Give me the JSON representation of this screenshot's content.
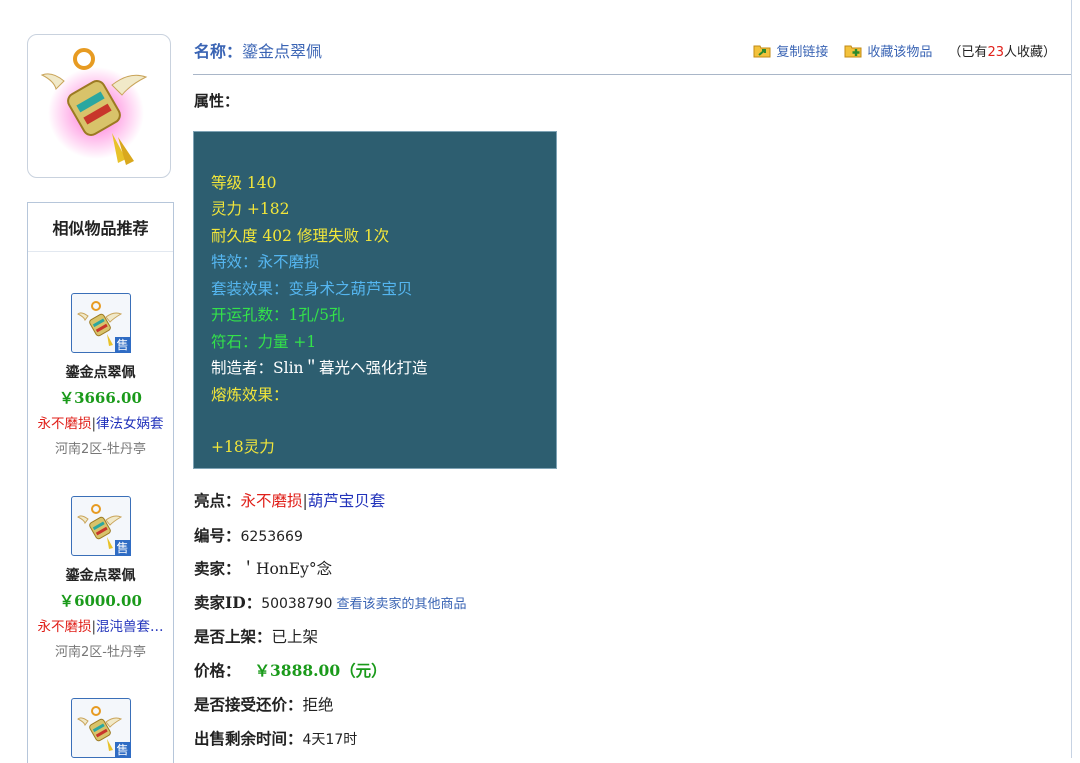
{
  "item": {
    "name_label": "名称：",
    "name": "鎏金点翠佩",
    "icon": "winged-pendant-icon"
  },
  "actions": {
    "copy_link": "复制链接",
    "favorite": "收藏该物品",
    "fav_prefix": "（已有",
    "fav_count": "23",
    "fav_suffix": "人收藏）"
  },
  "attributes": {
    "label": "属性：",
    "lines": [
      {
        "text": "等级 140",
        "color": "#f2e63a"
      },
      {
        "text": "灵力 +182",
        "color": "#f2e63a"
      },
      {
        "text": "耐久度 402 修理失败 1次",
        "color": "#f2e63a"
      },
      {
        "text": "特效：永不磨损",
        "color": "#55b6f0"
      },
      {
        "text": "套装效果：变身术之葫芦宝贝",
        "color": "#55b6f0"
      },
      {
        "text": "开运孔数：1孔/5孔",
        "color": "#33e24a"
      },
      {
        "text": "符石：力量 +1",
        "color": "#33e24a"
      },
      {
        "text": "制造者：Slin＂暮光ヘ强化打造",
        "color": "#ffffff"
      },
      {
        "text": "熔炼效果：",
        "color": "#f2e63a"
      },
      {
        "text": "+18灵力",
        "color": "#f2e63a"
      }
    ]
  },
  "details": {
    "highlight_label": "亮点：",
    "highlight_tag1": "永不磨损",
    "highlight_sep": "|",
    "highlight_tag2": "葫芦宝贝套",
    "id_label": "编号：",
    "id_value": "6253669",
    "seller_label": "卖家：",
    "seller_value": "＇HonEy°念",
    "seller_id_label": "卖家ID：",
    "seller_id_value": "50038790",
    "seller_other_link": "查看该卖家的其他商品",
    "listed_label": "是否上架：",
    "listed_value": "已上架",
    "price_label": "价格：",
    "price_value": "￥3888.00（元）",
    "counter_label": "是否接受还价：",
    "counter_value": "拒绝",
    "remaining_label": "出售剩余时间：",
    "remaining_value": "4天17时"
  },
  "sidebar": {
    "title": "相似物品推荐",
    "sell_badge": "售",
    "items": [
      {
        "name": "鎏金点翠佩",
        "price": "￥3666.00",
        "tag1": "永不磨损",
        "sep": "|",
        "tag2": "律法女娲套",
        "server": "河南2区-牡丹亭",
        "icon": "winged-pendant-icon"
      },
      {
        "name": "鎏金点翠佩",
        "price": "￥6000.00",
        "tag1": "永不磨损",
        "sep": "|",
        "tag2": "混沌兽套…",
        "server": "河南2区-牡丹亭",
        "icon": "winged-pendant-icon"
      },
      {
        "icon": "winged-pendant-icon"
      }
    ]
  },
  "colors": {
    "accent_blue": "#3a64b4",
    "price_green": "#1a9a1a",
    "tag_red": "#e0201a",
    "attr_box_bg": "#2d5e70"
  }
}
